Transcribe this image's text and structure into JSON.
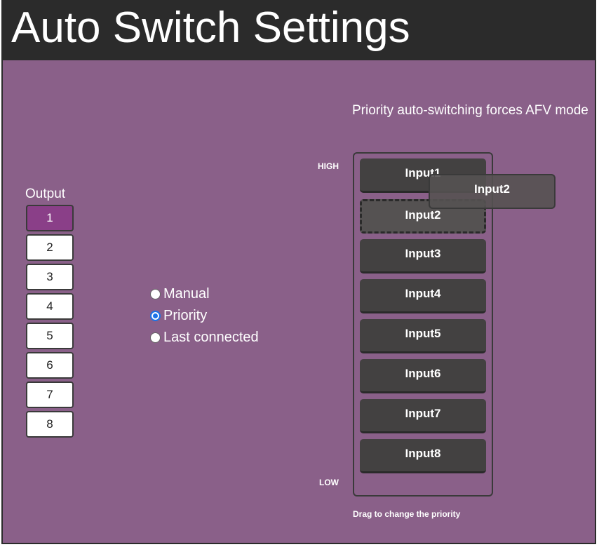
{
  "header": {
    "title": "Auto Switch Settings"
  },
  "colors": {
    "background": "#8a6089",
    "titlebar": "#2b2b2b",
    "active_output": "#8a3f88",
    "input_button": "#434141"
  },
  "output": {
    "label": "Output",
    "selected": "1",
    "buttons": [
      "1",
      "2",
      "3",
      "4",
      "5",
      "6",
      "7",
      "8"
    ]
  },
  "mode": {
    "options": [
      {
        "label": "Manual",
        "checked": false
      },
      {
        "label": "Priority",
        "checked": true
      },
      {
        "label": "Last connected",
        "checked": false
      }
    ]
  },
  "priority": {
    "note": "Priority auto-switching forces AFV mode",
    "high_label": "HIGH",
    "low_label": "LOW",
    "inputs": [
      "Input1",
      "Input2",
      "Input3",
      "Input4",
      "Input5",
      "Input6",
      "Input7",
      "Input8"
    ],
    "dragging": "Input2",
    "hint": "Drag to change the priority"
  }
}
